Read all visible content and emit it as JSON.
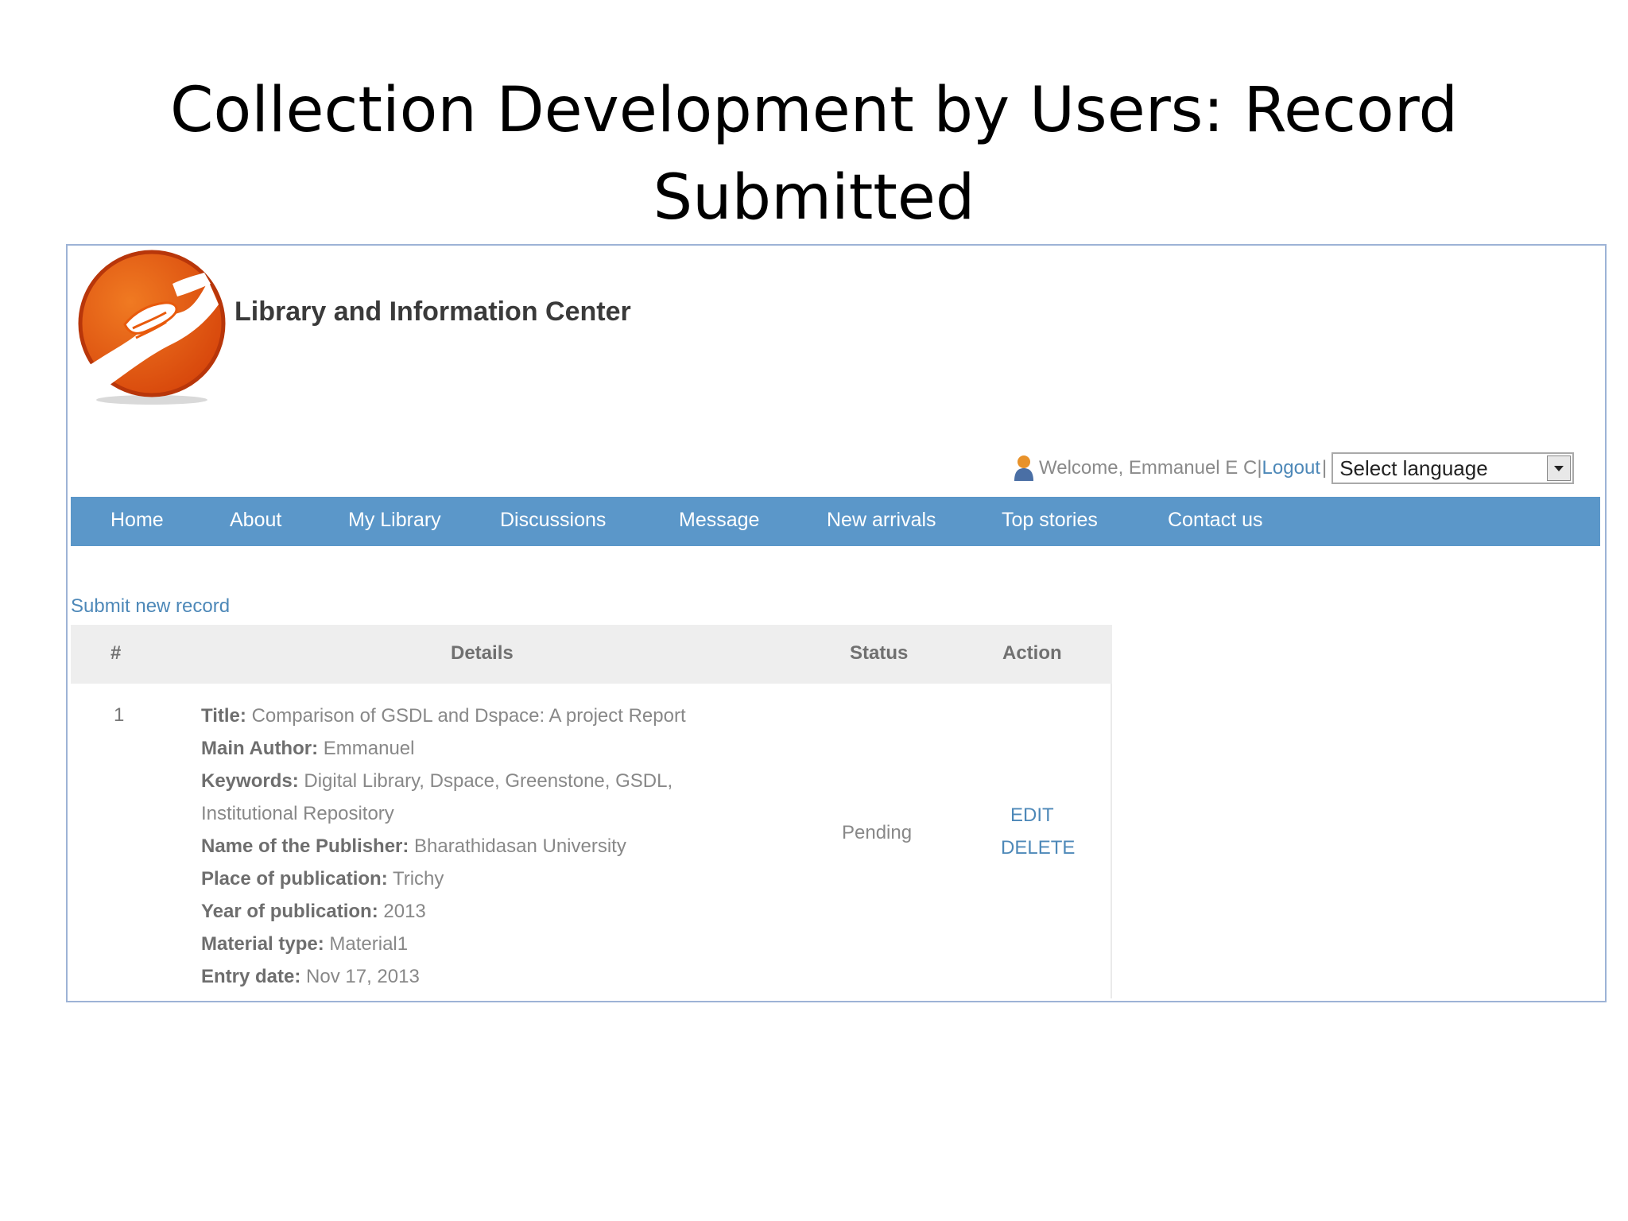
{
  "slide": {
    "title_line1": "Collection Development by Users: Record",
    "title_line2": "Submitted"
  },
  "header": {
    "site_name": "Library and Information Center"
  },
  "user_bar": {
    "welcome": "Welcome, Emmanuel E C",
    "separator1": "|",
    "logout": "Logout",
    "separator2": "|",
    "language_selected": "Select language"
  },
  "nav": {
    "items": [
      {
        "label": "Home"
      },
      {
        "label": "About"
      },
      {
        "label": "My Library"
      },
      {
        "label": "Discussions"
      },
      {
        "label": "Message"
      },
      {
        "label": "New arrivals"
      },
      {
        "label": "Top stories"
      },
      {
        "label": "Contact us"
      }
    ]
  },
  "main": {
    "submit_link": "Submit new record",
    "table": {
      "headers": {
        "num": "#",
        "details": "Details",
        "status": "Status",
        "action": "Action"
      },
      "rows": [
        {
          "num": "1",
          "fields": [
            {
              "label": "Title:",
              "value": " Comparison of GSDL and Dspace: A project Report"
            },
            {
              "label": "Main Author:",
              "value": " Emmanuel"
            },
            {
              "label": "Keywords:",
              "value": " Digital Library, Dspace, Greenstone, GSDL,"
            },
            {
              "label": "",
              "value": "Institutional Repository"
            },
            {
              "label": "Name of the Publisher:",
              "value": " Bharathidasan University"
            },
            {
              "label": "Place of publication:",
              "value": " Trichy"
            },
            {
              "label": "Year of publication:",
              "value": " 2013"
            },
            {
              "label": "Material type:",
              "value": " Material1"
            },
            {
              "label": "Entry date:",
              "value": " Nov 17, 2013"
            }
          ],
          "status": "Pending",
          "edit": "EDIT",
          "delete": "DELETE"
        }
      ]
    }
  },
  "colors": {
    "nav_bg": "#5b97c9",
    "link": "#4d88b8",
    "logo_orange": "#e85a0c",
    "logo_ring": "#c9400b"
  },
  "icons": {
    "logo": "helping-hands-logo",
    "user": "user-icon",
    "dropdown": "chevron-down-icon"
  }
}
